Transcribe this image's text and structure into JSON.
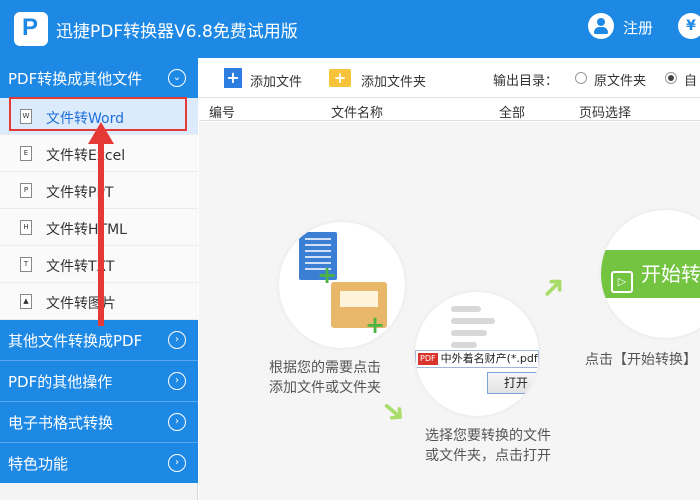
{
  "app": {
    "logo_letter": "P",
    "title": "迅捷PDF转换器V6.8免费试用版",
    "login_label": "注册",
    "vip_glyph": "¥"
  },
  "sidebar": {
    "section_open": {
      "label": "PDF转换成其他文件",
      "chevron": "⌄"
    },
    "items": [
      {
        "label": "文件转Word",
        "icon_letter": "W",
        "selected": true
      },
      {
        "label": "文件转Excel",
        "icon_letter": "E"
      },
      {
        "label": "文件转PPT",
        "icon_letter": "P"
      },
      {
        "label": "文件转HTML",
        "icon_letter": "H"
      },
      {
        "label": "文件转TXT",
        "icon_letter": "T"
      },
      {
        "label": "文件转图片",
        "icon_letter": "▲"
      }
    ],
    "sections": [
      {
        "label": "其他文件转换成PDF",
        "chevron": "›"
      },
      {
        "label": "PDF的其他操作",
        "chevron": "›"
      },
      {
        "label": "电子书格式转换",
        "chevron": "›"
      },
      {
        "label": "特色功能",
        "chevron": "›"
      }
    ]
  },
  "toolbar": {
    "add_file": "添加文件",
    "add_folder": "添加文件夹",
    "output_dir_label": "输出目录：",
    "radio_source": "原文件夹",
    "radio_custom": "自",
    "selected_output": "custom"
  },
  "table": {
    "columns": [
      "编号",
      "文件名称",
      "全部",
      "页码选择"
    ]
  },
  "steps": {
    "step1": {
      "line1": "根据您的需要点击",
      "line2": "添加文件或文件夹"
    },
    "step2": {
      "line1": "选择您要转换的文件",
      "line2": "或文件夹，点击打开",
      "path_text": "中外着名财产(*.pdf,*.",
      "open_button": "打开"
    },
    "step3": {
      "line1": "点击【开始转换】",
      "start_button": "开始转"
    }
  },
  "colors": {
    "accent": "#1e88e5",
    "highlight": "#e53935",
    "step_arrow": "#a8dd6a",
    "start_button": "#73c440"
  },
  "icons": {
    "add_file": "plus-icon",
    "add_folder": "folder-plus-icon",
    "login": "user-icon",
    "vip": "yen-icon"
  }
}
